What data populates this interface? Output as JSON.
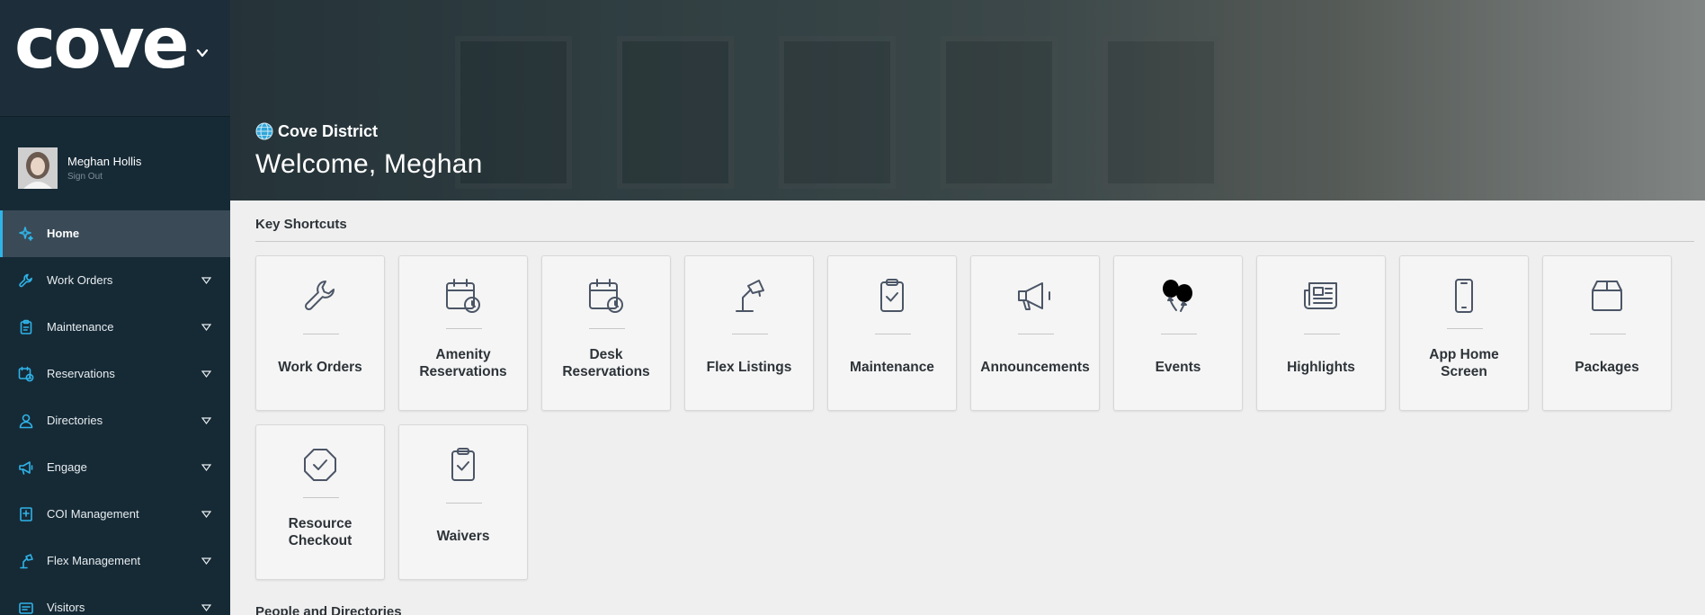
{
  "brand": {
    "logo_text": "cove"
  },
  "user": {
    "name": "Meghan Hollis",
    "sign_out": "Sign Out"
  },
  "nav": {
    "items": [
      {
        "label": "Home",
        "icon": "sparkle-icon",
        "active": true
      },
      {
        "label": "Work Orders",
        "icon": "wrench-icon"
      },
      {
        "label": "Maintenance",
        "icon": "clipboard-icon"
      },
      {
        "label": "Reservations",
        "icon": "calendar-clock-icon"
      },
      {
        "label": "Directories",
        "icon": "person-icon"
      },
      {
        "label": "Engage",
        "icon": "megaphone-icon"
      },
      {
        "label": "COI Management",
        "icon": "certificate-icon"
      },
      {
        "label": "Flex Management",
        "icon": "desk-lamp-icon"
      },
      {
        "label": "Visitors",
        "icon": "visitor-icon"
      }
    ]
  },
  "hero": {
    "district": "Cove District",
    "welcome": "Welcome, Meghan"
  },
  "shortcuts": {
    "title": "Key Shortcuts",
    "tiles": [
      {
        "label": "Work Orders",
        "icon": "wrench-icon"
      },
      {
        "label": "Amenity Reservations",
        "icon": "calendar-clock-icon"
      },
      {
        "label": "Desk Reservations",
        "icon": "calendar-clock-icon"
      },
      {
        "label": "Flex Listings",
        "icon": "desk-lamp-icon"
      },
      {
        "label": "Maintenance",
        "icon": "clipboard-check-icon"
      },
      {
        "label": "Announcements",
        "icon": "megaphone-icon"
      },
      {
        "label": "Events",
        "icon": "balloons-icon"
      },
      {
        "label": "Highlights",
        "icon": "newspaper-icon"
      },
      {
        "label": "App Home Screen",
        "icon": "phone-icon"
      },
      {
        "label": "Packages",
        "icon": "package-icon"
      },
      {
        "label": "Resource Checkout",
        "icon": "hexagon-check-icon"
      },
      {
        "label": "Waivers",
        "icon": "clipboard-check-icon"
      }
    ]
  },
  "people": {
    "title": "People and Directories"
  },
  "colors": {
    "sidebar": "#162a36",
    "accent": "#2fb3e8",
    "icon": "#4b5566"
  }
}
